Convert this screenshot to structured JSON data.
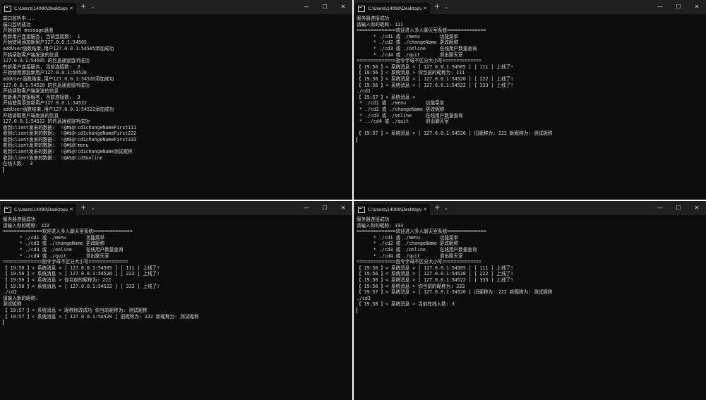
{
  "windows": [
    {
      "tab_title": "C:\\Users\\14090\\Desktop\\serve",
      "new_tab": "+",
      "tab_menu": "⌄",
      "controls": [
        "—",
        "☐",
        "✕"
      ],
      "lines": [
        "端口监听中...",
        "端口监听成功",
        "开始监听 message通道",
        "有新用户连接服务, 当前连接数:  1",
        "开始使用添加新用户127.0.0.1:54505",
        "addUser函数结束,用户127.0.0.1:54505添加成功",
        "开始读取客户端发送的信息",
        "127.0.0.1:54505 的信息通道监听成功",
        "有新用户连接服务, 当前连接数:  2",
        "开始使用添加新用户127.0.0.1:54520",
        "addUser函数结束,用户127.0.0.1:54520添加成功",
        "127.0.0.1:54520 的信息通道监听成功",
        "开始读取客户端发送的信息",
        "有新用户连接服务, 当前连接数:  3",
        "开始使用添加新用户127.0.0.1:54522",
        "addUser函数结束,用户127.0.0.1:54522添加成功",
        "开始读取客户端发送的信息",
        "127.0.0.1:54522 的信息通道监听成功",
        "收到client发来的数据:  !@#$@!cd1changeNameFirst111",
        "收到client发来的数据:  !@#$@!cd1changeNameFirst222",
        "收到client发来的数据:  !@#$@!cd1changeNameFirst333",
        "收到client发来的数据:  !@#$@!menu",
        "收到client发来的数据:  !@#$@!cd1changeName测试昵称",
        "收到client发来的数据:  !@#$@!cd3online",
        "在线人数:  3"
      ]
    },
    {
      "tab_title": "C:\\Users\\14090\\Desktop\\clie",
      "new_tab": "+",
      "tab_menu": "⌄",
      "controls": [
        "—",
        "☐",
        "✕"
      ],
      "lines": [
        "服务器连接成功",
        "请输入你的昵称: 111",
        "==============欢迎进入多人聊天室系统==============",
        "      * ./cd1 或 ./menu       功能菜单",
        "      * ./cd2 或 ./changeName 更改昵称",
        "      * ./cd3 或 ./online     在线用户数量查询",
        "      * ./cd4 或 ./quit       退出聊天室",
        "==============指令字母不区分大小写==============",
        "【 19:56 】< 系统消息 > [ 127.0.0.1:54505 ] [ 111 ] 上线了!",
        "【 19:56 】< 系统消息 > 你当前的昵称为: 111",
        "【 19:56 】< 系统消息 > [ 127.0.0.1:54520 ] [ 222 ] 上线了!",
        "【 19:56 】< 系统消息 > [ 127.0.0.1:54522 ] [ 333 ] 上线了!",
        "./cd1",
        "【 19:57 】< 系统消息 >",
        " * ./cd1 或 ./menu       功能菜单",
        " * ./cd2 或 ./changeName 更改昵称",
        " * ./cd3 或 ./online     在线用户数量查询",
        " * ../cd4 或 ./quit      退出聊天室",
        "",
        "【 19:57 】< 系统消息 > [ 127.0.0.1:54520 ] 旧昵称为: 222 新昵称为: 测试昵称"
      ]
    },
    {
      "tab_title": "C:\\Users\\14090\\Desktop\\clie",
      "new_tab": "+",
      "tab_menu": "⌄",
      "controls": [
        "—",
        "☐",
        "✕"
      ],
      "lines": [
        "服务器连接成功",
        "请输入你的昵称: 222",
        "==============欢迎进入多人聊天室系统==============",
        "      * ./cd1 或 ./menu       功能菜单",
        "      * ./cd2 或 ./changeName 更改昵称",
        "      * ./cd3 或 ./online     在线用户数量查询",
        "      * ./cd4 或 ./quit       退出聊天室",
        "==============指令字母不区分大小写==============",
        "【 19:56 】< 系统消息 > [ 127.0.0.1:54505 ] [ 111 ] 上线了!",
        "【 19:56 】< 系统消息 > [ 127.0.0.1:54520 ] [ 222 ] 上线了!",
        "【 19:56 】< 系统消息 > 你当前的昵称为: 222",
        "【 19:56 】< 系统消息 > [ 127.0.0.1:54522 ] [ 333 ] 上线了!",
        "./cd2",
        "请输入新的昵称:",
        "测试昵称",
        "【 19:57 】< 系统消息 > 昵称修改成功 你当前昵称为: 测试昵称",
        "【 19:57 】< 系统消息 > [ 127.0.0.1:54520 ] 旧昵称为: 222 新昵称为: 测试昵称"
      ]
    },
    {
      "tab_title": "C:\\Users\\14090\\Desktop\\clie",
      "new_tab": "+",
      "tab_menu": "⌄",
      "controls": [
        "—",
        "☐",
        "✕"
      ],
      "lines": [
        "服务器连接成功",
        "请输入你的昵称: 333",
        "==============欢迎进入多人聊天室系统==============",
        "      * ./cd1 或 ./menu       功能菜单",
        "      * ./cd2 或 ./changeName 更改昵称",
        "      * ./cd3 或 ./online     在线用户数量查询",
        "      * ./cd4 或 ./quit       退出聊天室",
        "==============指令字母不区分大小写==============",
        "【 19:56 】< 系统消息 > [ 127.0.0.1:54505 ] [ 111 ] 上线了!",
        "【 19:56 】< 系统消息 > [ 127.0.0.1:54520 ] [ 222 ] 上线了!",
        "【 19:56 】< 系统消息 > [ 127.0.0.1:54522 ] [ 333 ] 上线了!",
        "【 19:56 】< 系统消息 > 你当前的昵称为: 333",
        "【 19:57 】< 系统消息 > [ 127.0.0.1:54520 ] 旧昵称为: 222 新昵称为: 测试昵称",
        "./cd3",
        "【 19:58 】< 系统消息 > 当前在线人数: 3"
      ]
    }
  ]
}
